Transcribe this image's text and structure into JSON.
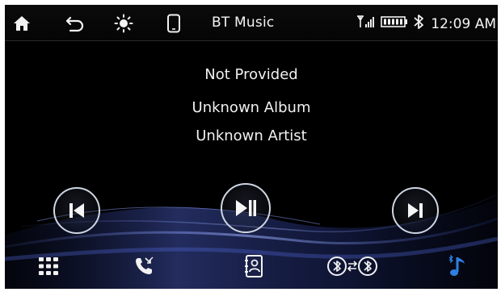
{
  "status_bar": {
    "title": "BT Music",
    "time": "12:09 AM",
    "icons": [
      "home-icon",
      "back-icon",
      "brightness-icon",
      "phone-device-icon",
      "signal-icon",
      "battery-icon",
      "bluetooth-icon"
    ]
  },
  "track": {
    "title": "Not Provided",
    "album": "Unknown Album",
    "artist": "Unknown Artist"
  },
  "controls": [
    "previous-track-icon",
    "play-pause-icon",
    "next-track-icon"
  ],
  "bottom_nav": [
    "apps-grid-icon",
    "call-log-icon",
    "contacts-icon",
    "bluetooth-connect-icon",
    "bluetooth-music-icon"
  ],
  "colors": {
    "background": "#000000",
    "text": "#f0f0f0",
    "accent_blue": "#2f7fe0",
    "swoosh": "#3b4fae"
  }
}
